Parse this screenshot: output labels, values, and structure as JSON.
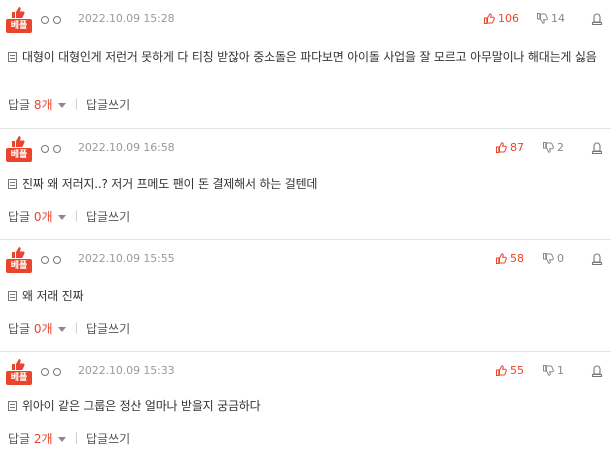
{
  "badge_label": "베플",
  "reply_prefix": "답글",
  "reply_write_label": "답글쓰기",
  "accent_color": "#e8452c",
  "comments": [
    {
      "date": "2022.10.09 15:28",
      "likes": "106",
      "dislikes": "14",
      "text": "대형이 대형인게 저런거 못하게 다 티칭 받잖아 중소돌은 파다보면 아이돌 사업을 잘 모르고 아무말이나 해대는게 싫음",
      "reply_count": "8개"
    },
    {
      "date": "2022.10.09 16:58",
      "likes": "87",
      "dislikes": "2",
      "text": "진짜 왜 저러지..? 저거 프메도 팬이 돈 결제해서 하는 걸텐데",
      "reply_count": "0개"
    },
    {
      "date": "2022.10.09 15:55",
      "likes": "58",
      "dislikes": "0",
      "text": "왜 저래 진짜",
      "reply_count": "0개"
    },
    {
      "date": "2022.10.09 15:33",
      "likes": "55",
      "dislikes": "1",
      "text": "위아이 같은 그룹은 정산 얼마나 받을지 궁금하다",
      "reply_count": "2개"
    }
  ]
}
